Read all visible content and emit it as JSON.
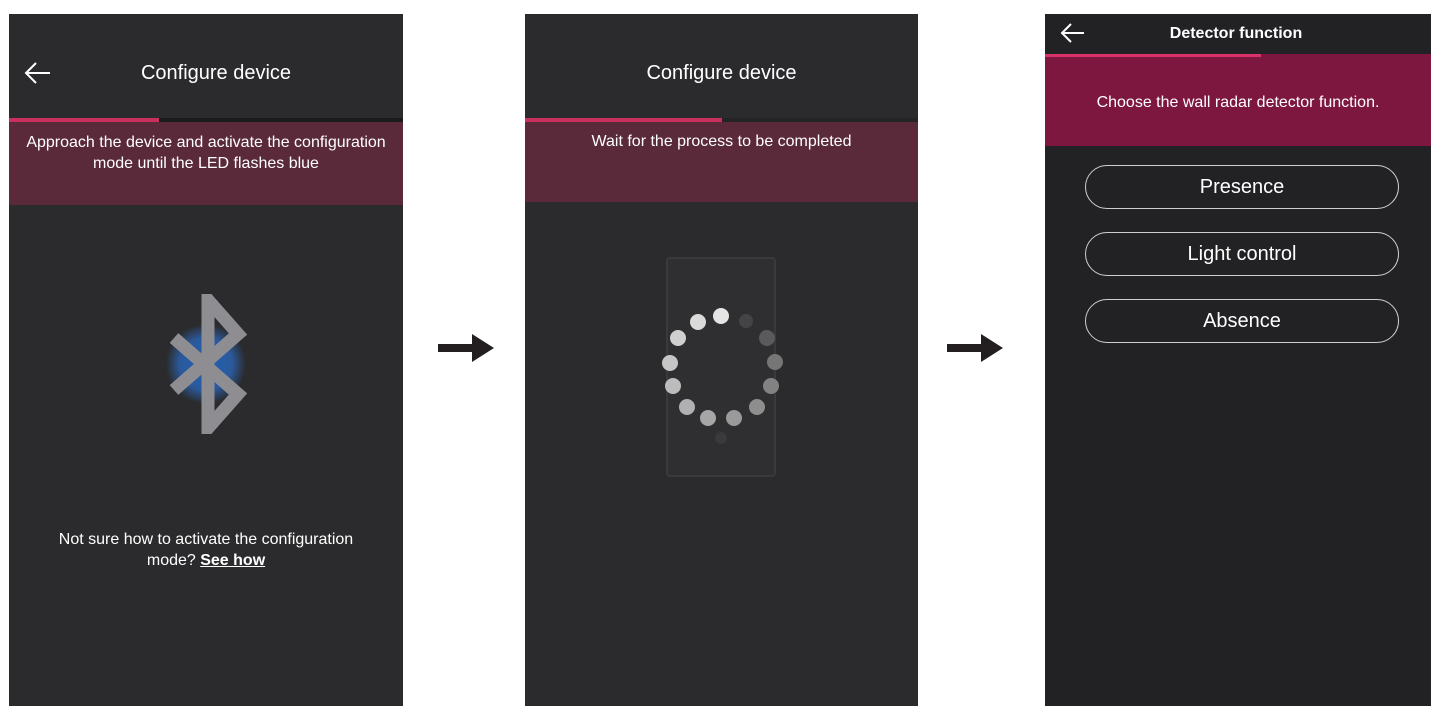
{
  "screen1": {
    "title": "Configure device",
    "instruction": "Approach the device and activate the configuration mode until the LED flashes blue",
    "help_text": "Not sure how to activate the configuration mode?",
    "help_link": "See how",
    "progress": 0.38
  },
  "screen2": {
    "title": "Configure device",
    "instruction": "Wait for the process to be completed",
    "progress": 0.5
  },
  "screen3": {
    "title": "Detector function",
    "instruction": "Choose the wall radar detector function.",
    "options": [
      "Presence",
      "Light control",
      "Absence"
    ],
    "progress": 0.56
  },
  "icons": {
    "back": "arrow-left-icon",
    "bluetooth": "bluetooth-icon",
    "spinner": "loading-spinner-icon",
    "step": "arrow-right-icon"
  },
  "colors": {
    "screen_bg": "#2b2b2d",
    "accent": "#c8315e",
    "banner_muted": "#5a2a3a",
    "banner_strong": "#7d1740"
  }
}
